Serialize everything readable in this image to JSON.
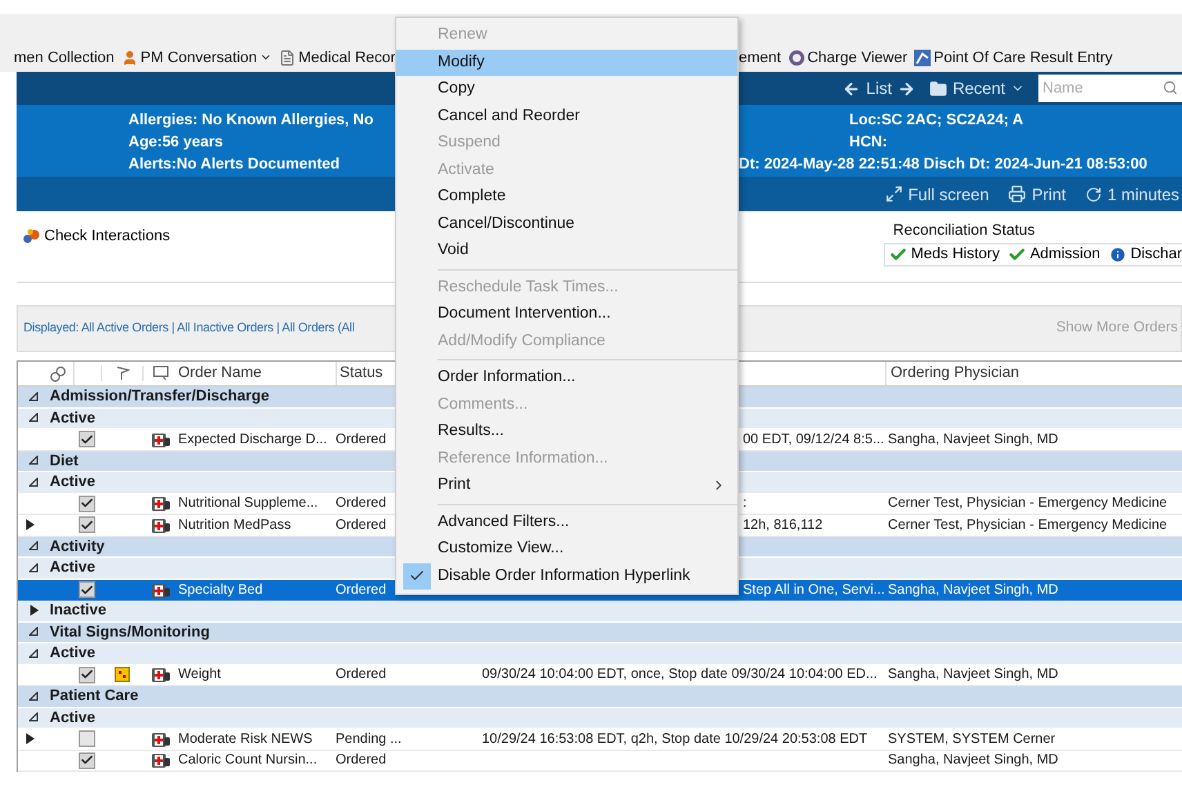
{
  "toolbar": {
    "specimen_collection": "men Collection",
    "pm_conversation": "PM Conversation",
    "medical_record": "Medical Recor",
    "tool_4": "ement",
    "charge_viewer": "Charge Viewer",
    "point_of_care": "Point Of Care Result Entry"
  },
  "nav": {
    "list": "List",
    "recent": "Recent",
    "search": {
      "placeholder": "Name"
    }
  },
  "banner": {
    "allergies": "Allergies: No Known Allergies, No",
    "age": "Age:56 years",
    "alerts": "Alerts:No Alerts Documented",
    "location": "Loc:SC 2AC; SC2A24; A",
    "hcn": "HCN:",
    "dates": "Dt: 2024-May-28 22:51:48 Disch Dt: 2024-Jun-21 08:53:00"
  },
  "actions": {
    "full_screen": "Full screen",
    "print": "Print",
    "refresh": "1 minutes"
  },
  "check_interactions": "Check Interactions",
  "reconciliation": {
    "title": "Reconciliation Status",
    "items": [
      {
        "label": "Meds History",
        "complete": true
      },
      {
        "label": "Admission",
        "complete": true
      },
      {
        "label": "Dischar",
        "complete": false
      }
    ]
  },
  "filter_bar": {
    "displayed": "Displayed: All Active Orders | All Inactive Orders | All Orders (All",
    "show_more": "Show More Orders"
  },
  "table": {
    "columns": [
      "Order Name",
      "Status",
      "Ordering Physician"
    ],
    "rows": [
      {
        "kind": "group",
        "label": "Admission/Transfer/Discharge",
        "expanded": true
      },
      {
        "kind": "subgroup",
        "label": "Active",
        "expanded": true
      },
      {
        "kind": "order",
        "name": "Expected Discharge D...",
        "status": "Ordered",
        "details": "00 EDT, 09/12/24 8:5...",
        "physician": "Sangha, Navjeet Singh, MD",
        "checked": true,
        "expandable": false,
        "alert": false,
        "selected": false
      },
      {
        "kind": "group",
        "label": "Diet",
        "expanded": true
      },
      {
        "kind": "subgroup",
        "label": "Active",
        "expanded": true
      },
      {
        "kind": "order",
        "name": "Nutritional Suppleme...",
        "status": "Ordered",
        "details": ":",
        "physician": "Cerner Test, Physician - Emergency Medicine",
        "checked": true,
        "expandable": false,
        "alert": false,
        "selected": false
      },
      {
        "kind": "order",
        "name": "Nutrition MedPass",
        "status": "Ordered",
        "details": "12h, 816,112",
        "physician": "Cerner Test, Physician - Emergency Medicine",
        "checked": true,
        "expandable": true,
        "alert": false,
        "selected": false
      },
      {
        "kind": "group",
        "label": "Activity",
        "expanded": true
      },
      {
        "kind": "subgroup",
        "label": "Active",
        "expanded": true
      },
      {
        "kind": "order",
        "name": "Specialty Bed",
        "status": "Ordered",
        "details": "Step All in One, Servi...",
        "physician": "Sangha, Navjeet Singh, MD",
        "checked": true,
        "expandable": false,
        "alert": false,
        "selected": true
      },
      {
        "kind": "subgroup",
        "label": "Inactive",
        "expanded": false
      },
      {
        "kind": "group",
        "label": "Vital Signs/Monitoring",
        "expanded": true
      },
      {
        "kind": "subgroup",
        "label": "Active",
        "expanded": true
      },
      {
        "kind": "order",
        "name": "Weight",
        "status": "Ordered",
        "details": "09/30/24 10:04:00 EDT, once, Stop date 09/30/24 10:04:00 ED...",
        "physician": "Sangha, Navjeet Singh, MD",
        "checked": true,
        "expandable": false,
        "alert": true,
        "selected": false
      },
      {
        "kind": "group",
        "label": "Patient Care",
        "expanded": true
      },
      {
        "kind": "subgroup",
        "label": "Active",
        "expanded": true
      },
      {
        "kind": "order",
        "name": "Moderate Risk NEWS",
        "status": "Pending ...",
        "details": "10/29/24 16:53:08 EDT, q2h, Stop date 10/29/24 20:53:08 EDT",
        "physician": "SYSTEM, SYSTEM Cerner",
        "checked": false,
        "expandable": true,
        "alert": false,
        "selected": false
      },
      {
        "kind": "order",
        "name": "Caloric Count Nursin...",
        "status": "Ordered",
        "details": "",
        "physician": "Sangha, Navjeet Singh, MD",
        "checked": true,
        "expandable": false,
        "alert": false,
        "selected": false
      }
    ]
  },
  "context_menu": {
    "items": [
      {
        "kind": "item",
        "label": "Renew",
        "disabled": true,
        "selected": false,
        "checked": false,
        "submenu": false
      },
      {
        "kind": "item",
        "label": "Modify",
        "disabled": false,
        "selected": true,
        "checked": false,
        "submenu": false
      },
      {
        "kind": "item",
        "label": "Copy",
        "disabled": false,
        "selected": false,
        "checked": false,
        "submenu": false
      },
      {
        "kind": "item",
        "label": "Cancel and Reorder",
        "disabled": false,
        "selected": false,
        "checked": false,
        "submenu": false
      },
      {
        "kind": "item",
        "label": "Suspend",
        "disabled": true,
        "selected": false,
        "checked": false,
        "submenu": false
      },
      {
        "kind": "item",
        "label": "Activate",
        "disabled": true,
        "selected": false,
        "checked": false,
        "submenu": false
      },
      {
        "kind": "item",
        "label": "Complete",
        "disabled": false,
        "selected": false,
        "checked": false,
        "submenu": false
      },
      {
        "kind": "item",
        "label": "Cancel/Discontinue",
        "disabled": false,
        "selected": false,
        "checked": false,
        "submenu": false
      },
      {
        "kind": "item",
        "label": "Void",
        "disabled": false,
        "selected": false,
        "checked": false,
        "submenu": false
      },
      {
        "kind": "separator"
      },
      {
        "kind": "item",
        "label": "Reschedule Task Times...",
        "disabled": true,
        "selected": false,
        "checked": false,
        "submenu": false
      },
      {
        "kind": "item",
        "label": "Document Intervention...",
        "disabled": false,
        "selected": false,
        "checked": false,
        "submenu": false
      },
      {
        "kind": "item",
        "label": "Add/Modify Compliance",
        "disabled": true,
        "selected": false,
        "checked": false,
        "submenu": false
      },
      {
        "kind": "separator"
      },
      {
        "kind": "item",
        "label": "Order Information...",
        "disabled": false,
        "selected": false,
        "checked": false,
        "submenu": false
      },
      {
        "kind": "item",
        "label": "Comments...",
        "disabled": true,
        "selected": false,
        "checked": false,
        "submenu": false
      },
      {
        "kind": "item",
        "label": "Results...",
        "disabled": false,
        "selected": false,
        "checked": false,
        "submenu": false
      },
      {
        "kind": "item",
        "label": "Reference Information...",
        "disabled": true,
        "selected": false,
        "checked": false,
        "submenu": false
      },
      {
        "kind": "item",
        "label": "Print",
        "disabled": false,
        "selected": false,
        "checked": false,
        "submenu": true
      },
      {
        "kind": "separator"
      },
      {
        "kind": "item",
        "label": "Advanced Filters...",
        "disabled": false,
        "selected": false,
        "checked": false,
        "submenu": false
      },
      {
        "kind": "item",
        "label": "Customize View...",
        "disabled": false,
        "selected": false,
        "checked": false,
        "submenu": false
      },
      {
        "kind": "item",
        "label": "Disable Order Information Hyperlink",
        "disabled": false,
        "selected": false,
        "checked": true,
        "submenu": false
      }
    ]
  }
}
